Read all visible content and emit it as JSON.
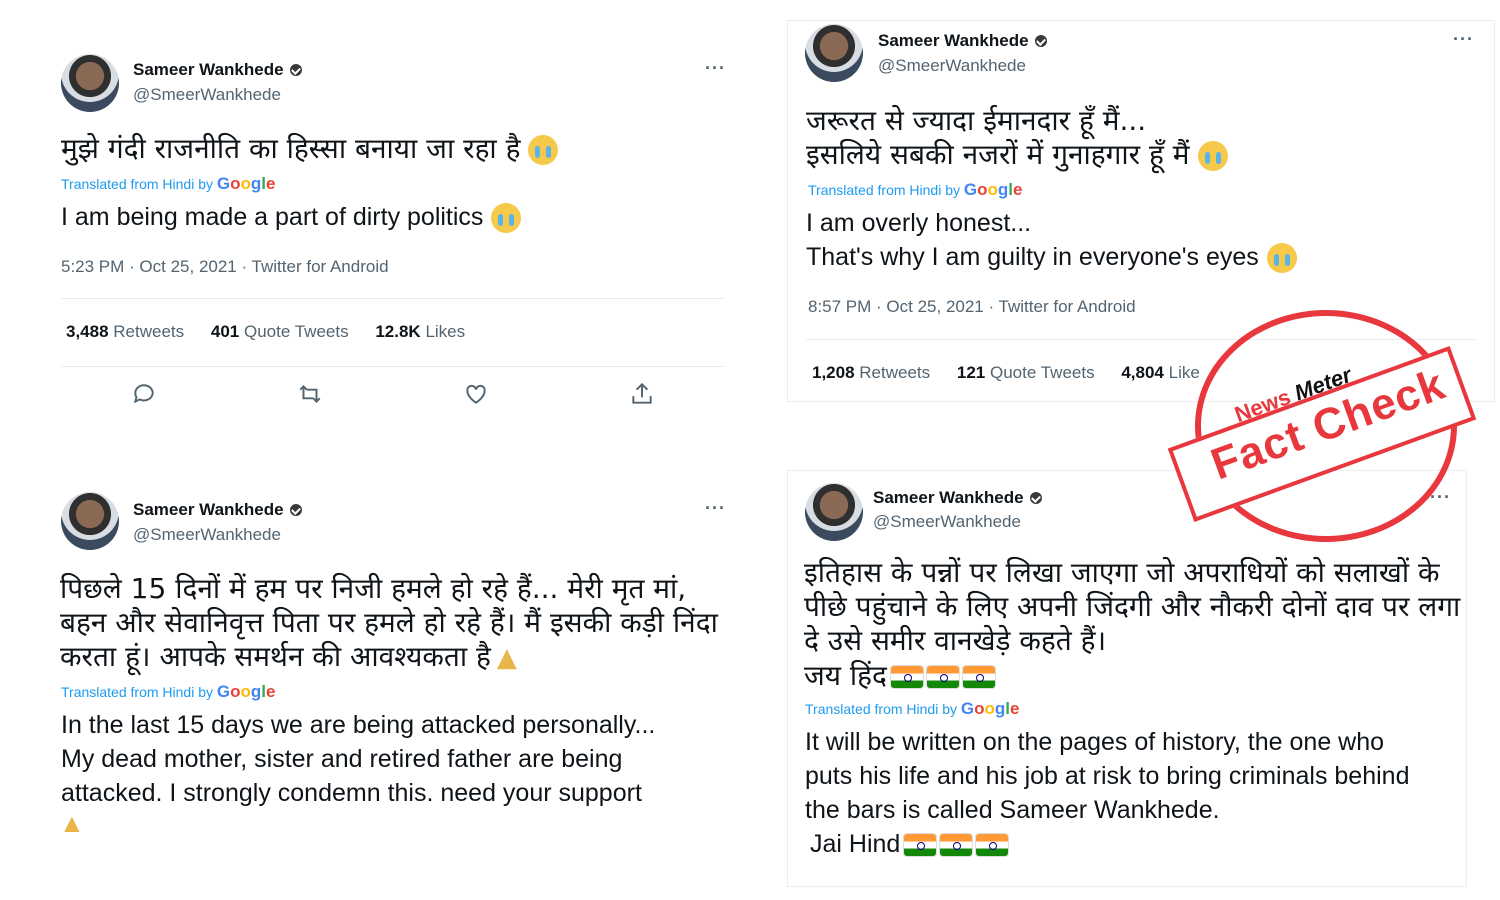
{
  "tweets": [
    {
      "name": "Sameer Wankhede",
      "handle": "@SmeerWankhede",
      "hindi": "मुझे गंदी राजनीति का हिस्सा बनाया जा रहा है",
      "translated_label": "Translated from Hindi by",
      "google": "Google",
      "english": "I am being made a part of dirty politics",
      "timestamp": "5:23 PM · Oct 25, 2021 · Twitter for Android",
      "retweets": "3,488",
      "retweets_label": "Retweets",
      "quotes": "401",
      "quotes_label": "Quote Tweets",
      "likes": "12.8K",
      "likes_label": "Likes"
    },
    {
      "name": "Sameer Wankhede",
      "handle": "@SmeerWankhede",
      "hindi": "जरूरत से ज्यादा ईमानदार हूँ मैं...\nइसलिये सबकी नजरों में गुनाहगार हूँ मैं",
      "translated_label": "Translated from Hindi by",
      "google": "Google",
      "english": "I am overly honest...\n That's why I am guilty in everyone's eyes",
      "timestamp": "8:57 PM · Oct 25, 2021 · Twitter for Android",
      "retweets": "1,208",
      "retweets_label": "Retweets",
      "quotes": "121",
      "quotes_label": "Quote Tweets",
      "likes": "4,804",
      "likes_label": "Like"
    },
    {
      "name": "Sameer Wankhede",
      "handle": "@SmeerWankhede",
      "hindi": "पिछले 15 दिनों में हम पर निजी हमले हो रहे हैं... मेरी मृत मां,\nबहन और सेवानिवृत्त पिता पर हमले हो रहे हैं। मैं इसकी कड़ी निंदा\nकरता हूं। आपके समर्थन की आवश्यकता है",
      "translated_label": "Translated from Hindi by",
      "google": "Google",
      "english": "In the last 15 days we are being attacked personally...\nMy dead mother, sister and retired father are being\nattacked. I strongly condemn this. need your support"
    },
    {
      "name": "Sameer Wankhede",
      "handle": "@SmeerWankhede",
      "hindi": "इतिहास के पन्नों पर लिखा जाएगा जो अपराधियों को सलाखों के\nपीछे पहुंचाने के लिए अपनी जिंदगी और नौकरी दोनों दाव पर लगा\nदे उसे समीर वानखेड़े कहते हैं।",
      "hindi_jai": "जय हिंद",
      "translated_label": "Translated from Hindi by",
      "google": "Google",
      "english": "It will be written on the pages of history, the one who\nputs his life and his job at risk to bring criminals behind\nthe bars is called Sameer Wankhede.",
      "english_jai": "Jai Hind"
    }
  ],
  "stamp": {
    "brand_news": "News",
    "brand_meter": "Meter",
    "label": "Fact Check",
    "color": "#e8373d"
  }
}
